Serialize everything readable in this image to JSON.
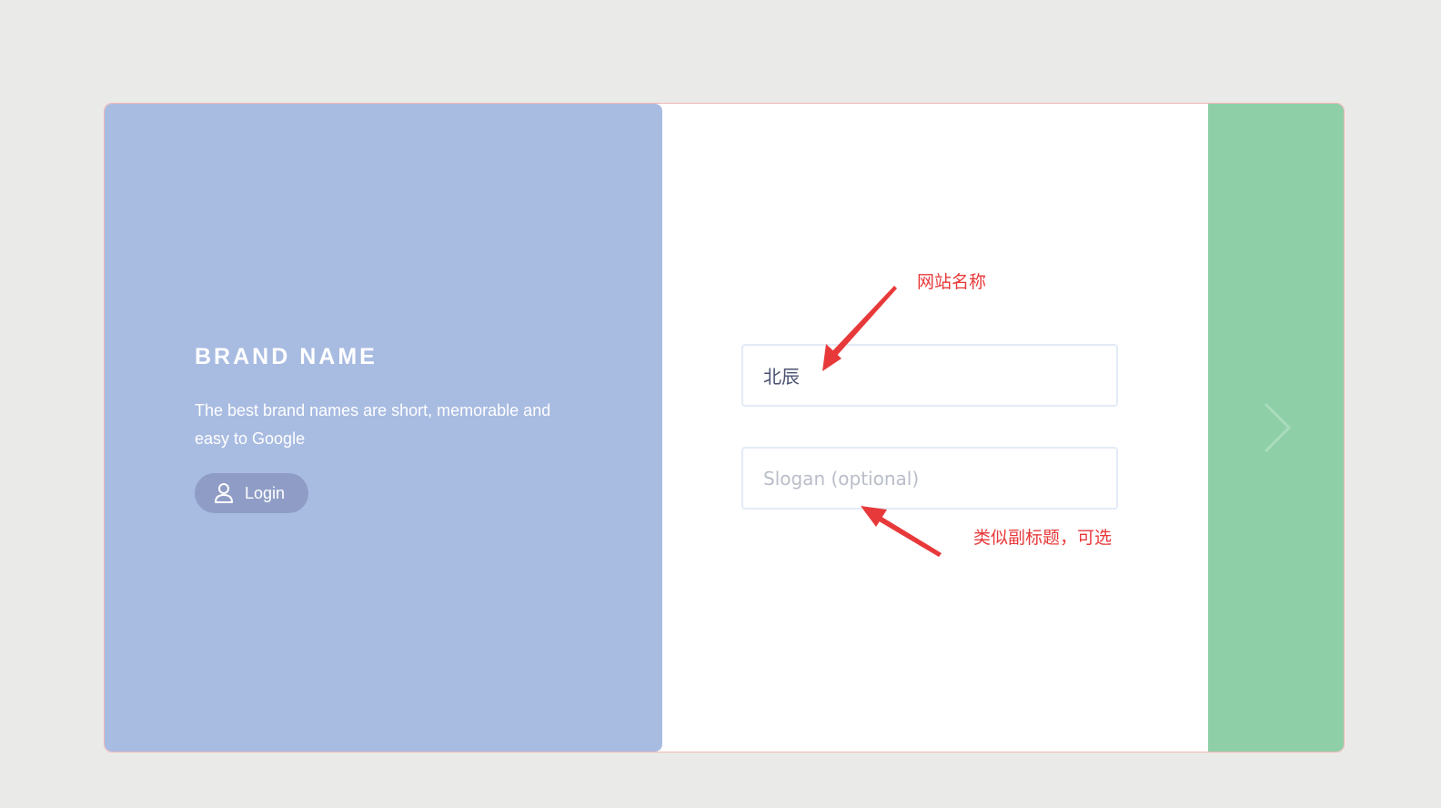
{
  "left": {
    "brand_title": "BRAND NAME",
    "brand_description": "The best brand names are short, memorable and easy to Google",
    "login_label": "Login",
    "login_icon": "user-icon"
  },
  "form": {
    "site_name_value": "北辰",
    "slogan_placeholder": "Slogan (optional)"
  },
  "right": {
    "next_icon": "chevron-right-icon"
  },
  "annotations": {
    "site_name_note": "网站名称",
    "slogan_note": "类似副标题，可选"
  },
  "colors": {
    "page_bg": "#eaeae8",
    "left_panel": "#a8bbe1",
    "login_button": "#8f9dc6",
    "right_panel": "#8ecfa8",
    "annotation": "#e8393a"
  }
}
